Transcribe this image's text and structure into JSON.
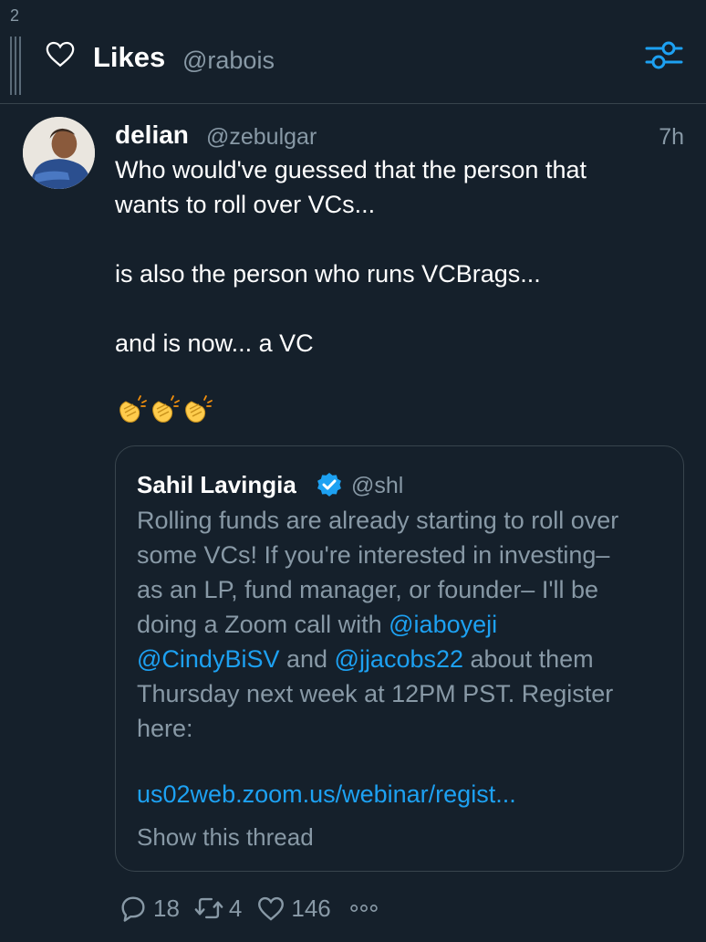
{
  "column": {
    "number": "2"
  },
  "header": {
    "title": "Likes",
    "handle": "@rabois",
    "icon": "heart-outline-icon",
    "filter_icon": "sliders-icon"
  },
  "tweet": {
    "author_name": "delian",
    "author_handle": "@zebulgar",
    "time": "7h",
    "text_lines": [
      "Who would've guessed that the person that",
      "wants to roll over VCs...",
      "",
      "is also the person who runs VCBrags...",
      "",
      "and is now... a VC"
    ],
    "emoji": [
      "clapping-hands",
      "clapping-hands",
      "clapping-hands"
    ],
    "quote": {
      "name": "Sahil Lavingia",
      "verified": true,
      "handle": "@shl",
      "line1": "Rolling funds are already starting to roll over",
      "line2": "some VCs! If you're interested in investing–",
      "line3": "as an LP, fund manager, or founder– I'll be",
      "line4_pre": "doing a Zoom call with ",
      "mention1": "@iaboyeji",
      "mention2": "@CindyBiSV",
      "line5_mid": " and ",
      "mention3": "@jjacobs22",
      "line5_post": " about them",
      "line6": "Thursday next week at 12PM PST. Register",
      "line7": "here:",
      "link": "us02web.zoom.us/webinar/regist...",
      "show_thread": "Show this thread"
    },
    "actions": {
      "replies": "18",
      "retweets": "4",
      "likes": "146"
    }
  },
  "colors": {
    "background": "#15202b",
    "accent": "#1da1f2",
    "muted": "#8899a6",
    "border": "#38444d",
    "emoji": "#ffcc4d"
  }
}
